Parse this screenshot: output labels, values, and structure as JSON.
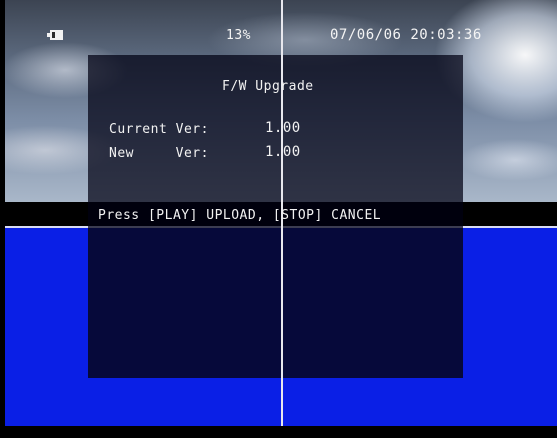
{
  "status_bar": {
    "battery_icon": "battery-icon",
    "battery_percent": "13%",
    "datetime": "07/06/06 20:03:36"
  },
  "dialog": {
    "title": "F/W Upgrade",
    "current_label": "Current Ver:",
    "current_value": "1.00",
    "new_label": "New     Ver:",
    "new_value": "1.00",
    "instruction": "Press [PLAY] UPLOAD, [STOP] CANCEL"
  },
  "colors": {
    "screen_blue": "#0a1fe6",
    "dialog_dark": "#06093a",
    "osd_text": "#f2f2f2"
  }
}
